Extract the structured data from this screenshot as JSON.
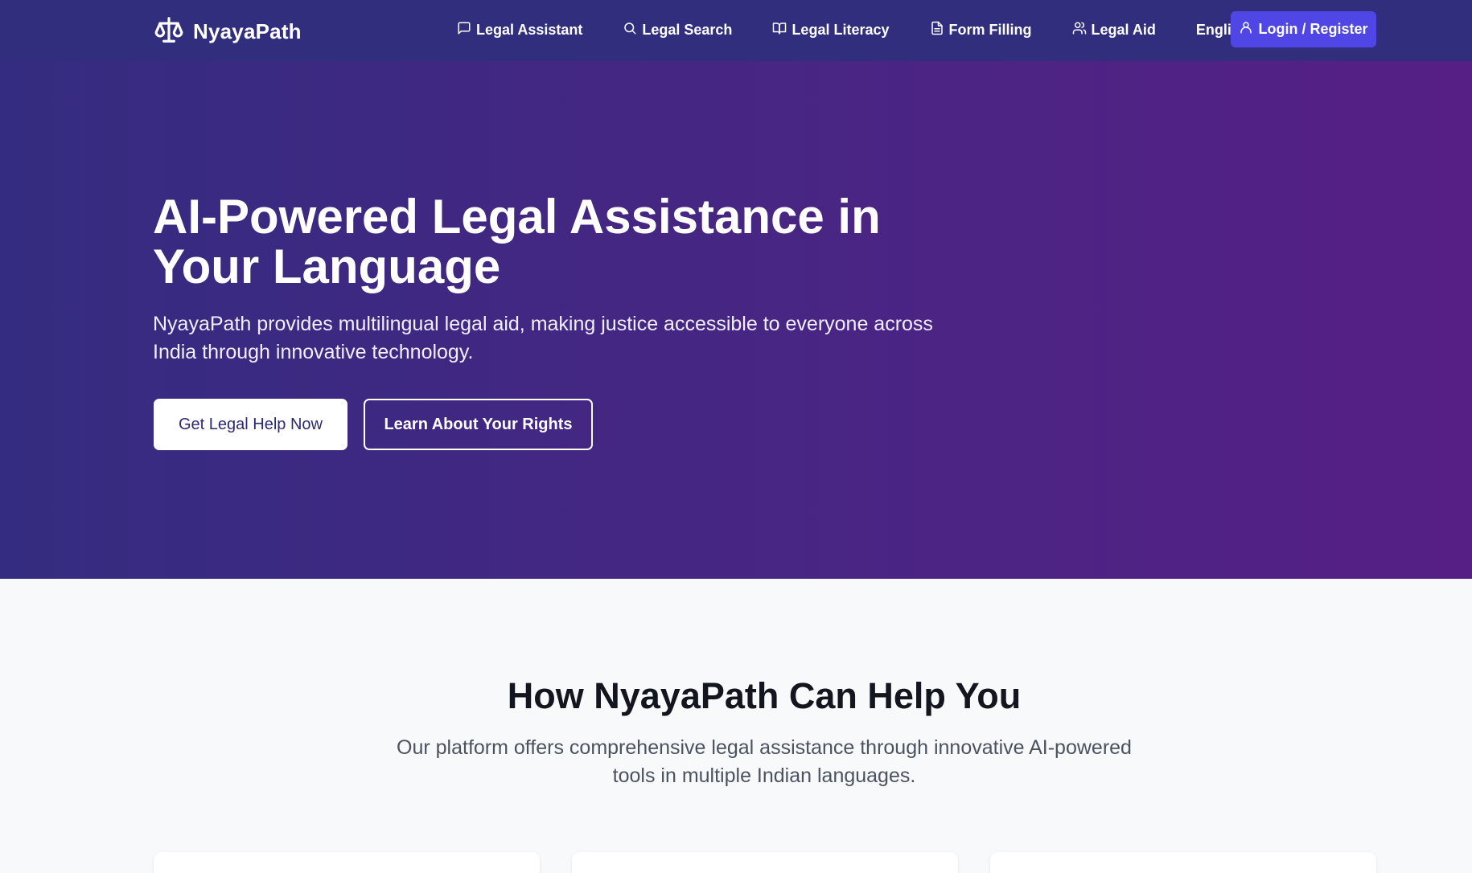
{
  "brand": {
    "name": "NyayaPath",
    "logo_icon": "scales-icon"
  },
  "nav": {
    "items": [
      {
        "label": "Legal Assistant",
        "icon": "chat-icon"
      },
      {
        "label": "Legal Search",
        "icon": "search-icon"
      },
      {
        "label": "Legal Literacy",
        "icon": "book-icon"
      },
      {
        "label": "Form Filling",
        "icon": "document-icon"
      },
      {
        "label": "Legal Aid",
        "icon": "users-icon"
      }
    ],
    "language": "English",
    "login_label": "Login / Register"
  },
  "hero": {
    "title": "AI-Powered Legal Assistance in Your Language",
    "subtitle": "NyayaPath provides multilingual legal aid, making justice accessible to everyone across India through innovative technology.",
    "primary_cta": "Get Legal Help Now",
    "secondary_cta": "Learn About Your Rights"
  },
  "features": {
    "title": "How NyayaPath Can Help You",
    "subtitle": "Our platform offers comprehensive legal assistance through innovative AI-powered tools in multiple Indian languages."
  },
  "colors": {
    "navbar_bg": "#312e7e",
    "hero_gradient_start": "#342c80",
    "hero_gradient_end": "#561f86",
    "accent": "#4f46e5"
  }
}
